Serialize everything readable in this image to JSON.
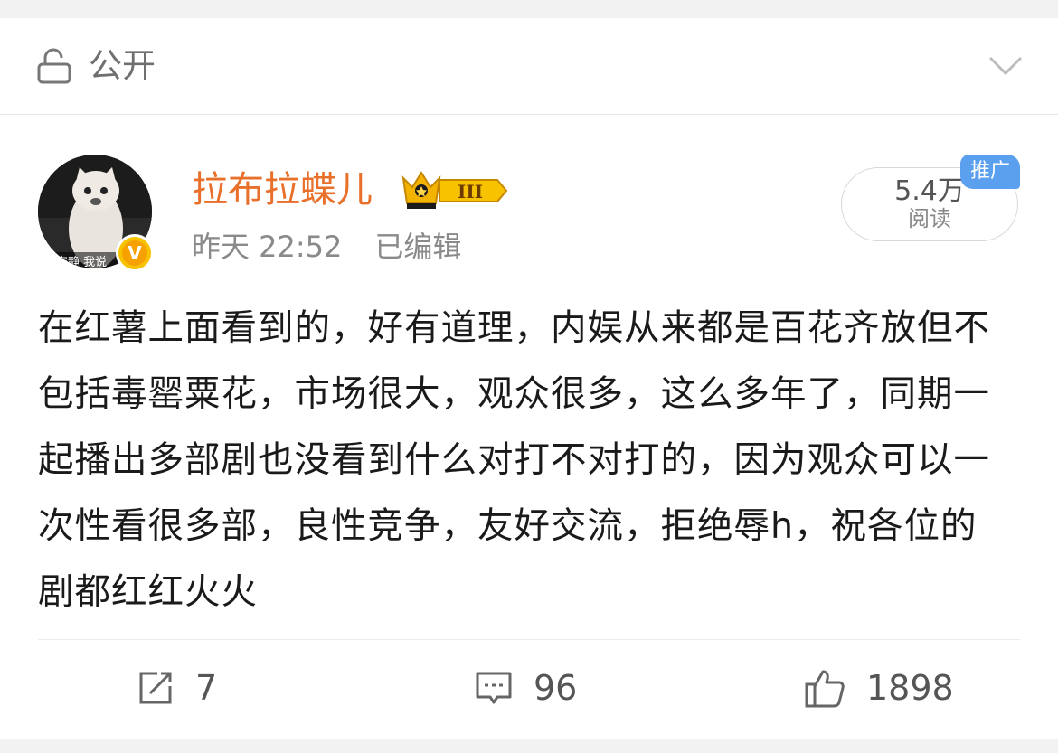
{
  "visibility": {
    "label": "公开",
    "icon": "lock-open-icon",
    "dropdown_icon": "chevron-down-icon"
  },
  "post": {
    "author": {
      "name": "拉布拉蝶儿",
      "avatar_text": "安静 我说",
      "verified_icon": "verified-v-icon",
      "badge_icon": "crown-level-badge",
      "badge_level": "III"
    },
    "time": "昨天 22:52",
    "edited_label": "已编辑",
    "reads": {
      "count": "5.4万",
      "label": "阅读",
      "promo_tag": "推广"
    },
    "text": "在红薯上面看到的，好有道理，内娱从来都是百花齐放但不包括毒罂粟花，市场很大，观众很多，这么多年了，同期一起播出多部剧也没看到什么对打不对打的，因为观众可以一次性看很多部，良性竞争，友好交流，拒绝辱h，祝各位的剧都红红火火"
  },
  "actions": {
    "share": {
      "icon": "share-icon",
      "count": "7"
    },
    "comment": {
      "icon": "comment-icon",
      "count": "96"
    },
    "like": {
      "icon": "thumbs-up-icon",
      "count": "1898"
    }
  },
  "colors": {
    "username": "#e9702a",
    "promo": "#5aa0ef",
    "verified": "#f7c200"
  }
}
